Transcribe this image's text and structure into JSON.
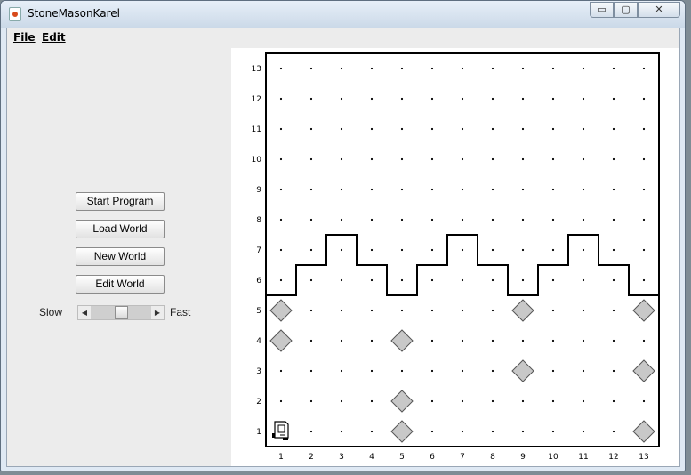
{
  "window": {
    "title": "StoneMasonKarel",
    "controls": {
      "minimize": "▭",
      "maximize": "▢",
      "close": "✕"
    }
  },
  "menu": {
    "file": "File",
    "edit": "Edit"
  },
  "controls": {
    "start_program": "Start Program",
    "load_world": "Load World",
    "new_world": "New World",
    "edit_world": "Edit World",
    "speed": {
      "slow_label": "Slow",
      "fast_label": "Fast",
      "level": 0.5
    }
  },
  "world": {
    "columns": 13,
    "rows": 13,
    "column_labels": [
      "1",
      "2",
      "3",
      "4",
      "5",
      "6",
      "7",
      "8",
      "9",
      "10",
      "11",
      "12",
      "13"
    ],
    "row_labels": [
      "1",
      "2",
      "3",
      "4",
      "5",
      "6",
      "7",
      "8",
      "9",
      "10",
      "11",
      "12",
      "13"
    ],
    "beepers": [
      {
        "col": 1,
        "row": 5
      },
      {
        "col": 1,
        "row": 4
      },
      {
        "col": 5,
        "row": 4
      },
      {
        "col": 5,
        "row": 2
      },
      {
        "col": 5,
        "row": 1
      },
      {
        "col": 9,
        "row": 5
      },
      {
        "col": 9,
        "row": 3
      },
      {
        "col": 13,
        "row": 5
      },
      {
        "col": 13,
        "row": 3
      },
      {
        "col": 13,
        "row": 1
      }
    ],
    "karel": {
      "col": 1,
      "row": 1,
      "facing": "east"
    },
    "colors": {
      "beeper_fill": "#c8c8c8",
      "wall": "#000000",
      "corner_dot": "#000000"
    }
  }
}
